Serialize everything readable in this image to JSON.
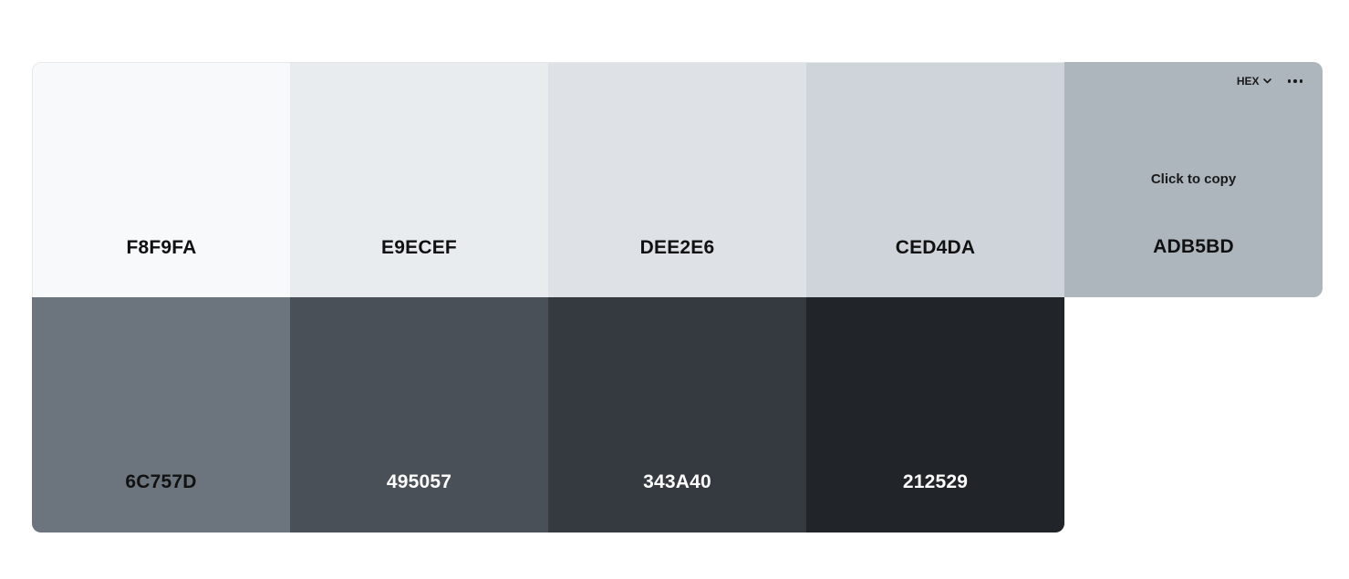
{
  "palette": {
    "format": "HEX",
    "hint": "Click to copy",
    "swatches": [
      {
        "code": "F8F9FA",
        "color": "#F8F9FA"
      },
      {
        "code": "E9ECEF",
        "color": "#E9ECEF"
      },
      {
        "code": "DEE2E6",
        "color": "#DEE2E6"
      },
      {
        "code": "CED4DA",
        "color": "#CED4DA"
      },
      {
        "code": "ADB5BD",
        "color": "#ADB5BD"
      },
      {
        "code": "6C757D",
        "color": "#6C757D"
      },
      {
        "code": "495057",
        "color": "#495057"
      },
      {
        "code": "343A40",
        "color": "#343A40"
      },
      {
        "code": "212529",
        "color": "#212529"
      }
    ]
  }
}
